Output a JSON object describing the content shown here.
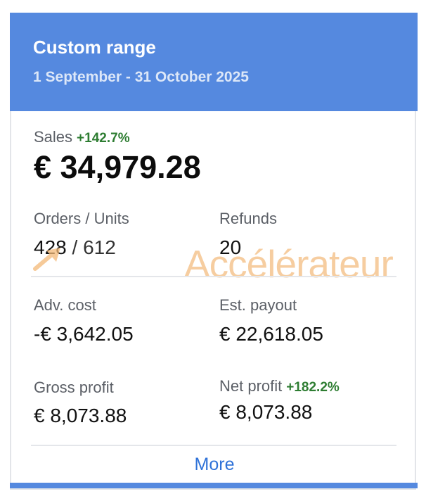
{
  "header": {
    "title": "Custom range",
    "date_range": "1 September - 31 October 2025"
  },
  "sales": {
    "label": "Sales",
    "change": "+142.7%",
    "value": "€ 34,979.28"
  },
  "orders_units": {
    "label": "Orders / Units",
    "orders": "428",
    "separator": "/",
    "units": "612"
  },
  "refunds": {
    "label": "Refunds",
    "value": "20"
  },
  "adv_cost": {
    "label": "Adv. cost",
    "value": "-€ 3,642.05"
  },
  "est_payout": {
    "label": "Est. payout",
    "value": "€ 22,618.05"
  },
  "gross_profit": {
    "label": "Gross profit",
    "value": "€ 8,073.88"
  },
  "net_profit": {
    "label": "Net profit",
    "change": "+182.2%",
    "value": "€ 8,073.88"
  },
  "more": {
    "label": "More"
  },
  "watermark": {
    "text": "Accélérateur"
  },
  "colors": {
    "header_bg": "#5589df",
    "positive": "#2e7d32",
    "link": "#2f72d8"
  }
}
